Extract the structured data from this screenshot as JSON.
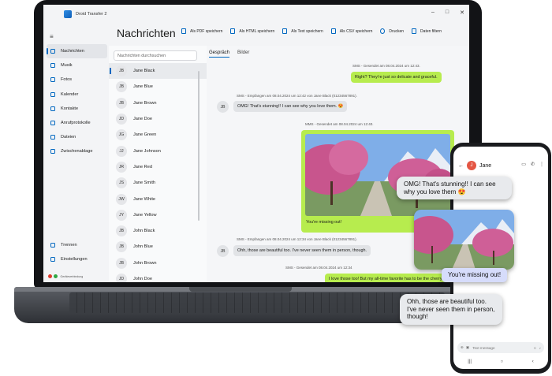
{
  "app": {
    "title": "Droid Transfer 2",
    "window_controls": [
      "–",
      "□",
      "✕"
    ]
  },
  "nav": {
    "items": [
      {
        "label": "Nachrichten",
        "icon": "message-icon",
        "active": true
      },
      {
        "label": "Musik",
        "icon": "music-icon"
      },
      {
        "label": "Fotos",
        "icon": "photo-icon"
      },
      {
        "label": "Kalender",
        "icon": "calendar-icon"
      },
      {
        "label": "Kontakte",
        "icon": "contacts-icon"
      },
      {
        "label": "Anrufprotokolle",
        "icon": "phone-icon"
      },
      {
        "label": "Dateien",
        "icon": "file-icon"
      },
      {
        "label": "Zwischenablage",
        "icon": "clipboard-icon"
      }
    ],
    "bottom": [
      {
        "label": "Trennen",
        "icon": "disconnect-icon"
      },
      {
        "label": "Einstellungen",
        "icon": "settings-icon"
      }
    ],
    "connection": "Geräteverbindung"
  },
  "header": {
    "title": "Nachrichten",
    "actions": [
      "Als PDF speichern",
      "Als HTML speichern",
      "Als Text speichern",
      "Als CSV speichern",
      "Drucken",
      "Daten filtern"
    ]
  },
  "contacts": {
    "search_placeholder": "Nachrichten durchsuchen",
    "list": [
      {
        "initials": "JB",
        "name": "Jane Black"
      },
      {
        "initials": "JB",
        "name": "Jane Blue"
      },
      {
        "initials": "JB",
        "name": "Jane Brown"
      },
      {
        "initials": "JD",
        "name": "Jane Doe"
      },
      {
        "initials": "JG",
        "name": "Jane Green"
      },
      {
        "initials": "JJ",
        "name": "Jane Johnson"
      },
      {
        "initials": "JR",
        "name": "Jane Red"
      },
      {
        "initials": "JS",
        "name": "Jane Smith"
      },
      {
        "initials": "JW",
        "name": "Jane White"
      },
      {
        "initials": "JY",
        "name": "Jane Yellow"
      },
      {
        "initials": "JB",
        "name": "John Black"
      },
      {
        "initials": "JB",
        "name": "John Blue"
      },
      {
        "initials": "JB",
        "name": "John Brown"
      },
      {
        "initials": "JD",
        "name": "John Doe"
      }
    ]
  },
  "chat": {
    "tabs": [
      "Gespräch",
      "Bilder"
    ],
    "messages": [
      {
        "meta": "SMS - Gesendet am 08.04.2024 um 12:43.",
        "text": "Right? They're just so delicate and graceful."
      },
      {
        "meta": "SMS - Empfangen am 08.04.2024 um 12:42 von Jane Black (01234567891).",
        "text": "OMG! That's stunning!! I can see why you love them. 😍",
        "avatar": "JB"
      },
      {
        "meta": "MMS - Gesendet am 08.04.2024 um 12:40.",
        "text": "You're missing out!"
      },
      {
        "meta": "SMS - Empfangen am 08.04.2024 um 12:34 von Jane Black (01234567891).",
        "text": "Ohh, those are beautiful too. I've never seen them in person, though.",
        "avatar": "JB"
      },
      {
        "meta": "SMS - Gesendet am 08.04.2024 um 12:34",
        "text": "I love those too! But my all-time favorite has to be the cherry blosso"
      }
    ]
  },
  "phone": {
    "contact_initial": "J",
    "contact_name": "Jane",
    "input_placeholder": "Text message",
    "bubbles": [
      "OMG! That's stunning!! I can see why you love them 😍",
      "You're missing out!",
      "Ohh, those are beautiful too. I've never seen them in person, though!"
    ]
  },
  "colors": {
    "accent": "#0067c0",
    "sent_bubble": "#b7ec4e",
    "received_bubble": "#e1e3e6",
    "phone_sent_bubble": "#d6dcfb",
    "contact_avatar": "#e45644"
  }
}
